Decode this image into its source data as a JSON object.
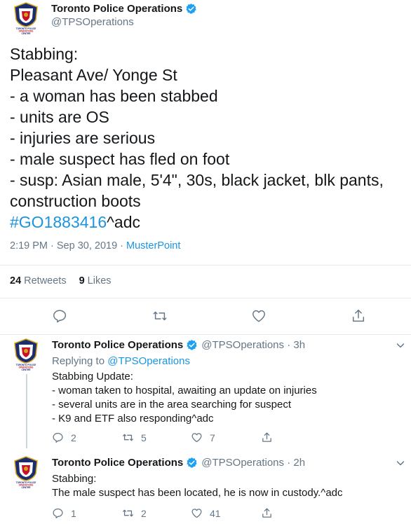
{
  "main_tweet": {
    "account_name": "Toronto Police Operations",
    "handle": "@TPSOperations",
    "logo_text": [
      "TORONTO POLICE",
      "OPERATIONS",
      "CENTRE"
    ],
    "text_lines": [
      "Stabbing:",
      "Pleasant Ave/ Yonge St",
      "- a woman has been stabbed",
      "- units are OS",
      "- injuries are serious",
      "- male suspect has fled on foot",
      "- susp: Asian male, 5'4\", 30s, black jacket, blk pants,",
      "construction boots"
    ],
    "hashtag": "#GO1883416",
    "hashtag_suffix": "^adc",
    "timestamp": "2:19 PM · Sep 30, 2019 ·",
    "source": "MusterPoint",
    "retweets_count": "24",
    "retweets_label": "Retweets",
    "likes_count": "9",
    "likes_label": "Likes"
  },
  "replies": [
    {
      "account_name": "Toronto Police Operations",
      "handle": "@TPSOperations · 3h",
      "replying_prefix": "Replying to",
      "replying_to": "@TPSOperations",
      "text_lines": [
        "Stabbing Update:",
        "- woman taken to hospital, awaiting an update on injuries",
        "- several units are in the area searching for suspect",
        "- K9 and ETF  also responding^adc"
      ],
      "reply_count": "2",
      "retweet_count": "5",
      "like_count": "7"
    },
    {
      "account_name": "Toronto Police Operations",
      "handle": "@TPSOperations · 2h",
      "text_lines": [
        "Stabbing:",
        "The male suspect has been located, he is now in custody.^adc"
      ],
      "reply_count": "1",
      "retweet_count": "2",
      "like_count": "41"
    }
  ],
  "icons": {
    "reply": "reply-icon",
    "retweet": "retweet-icon",
    "like": "heart-icon",
    "share": "share-icon",
    "verified": "verified-badge-icon",
    "more": "chevron-down-icon"
  },
  "colors": {
    "link": "#1b95e0",
    "secondary_text": "#657786",
    "primary_text": "#14171a",
    "divider": "#e6ecf0",
    "verified": "#1da1f2"
  }
}
